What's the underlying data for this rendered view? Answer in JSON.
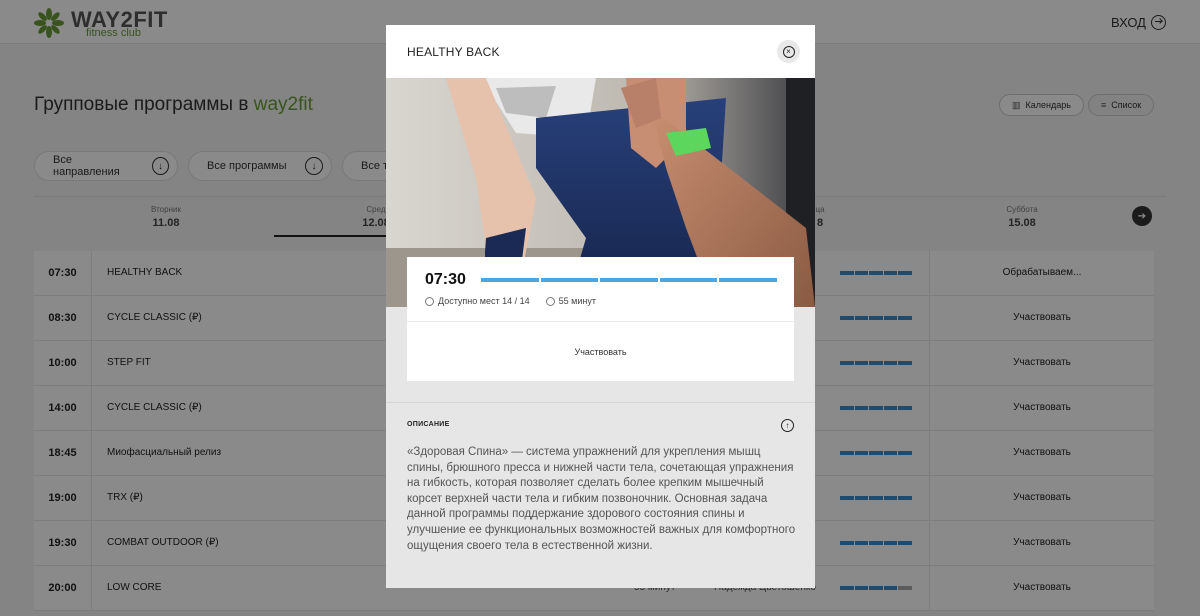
{
  "header": {
    "logo_title": "WAY2FIT",
    "logo_sub": "fitness club",
    "login_label": "ВХОД"
  },
  "page": {
    "title": "Групповые программы в",
    "title_accent": "way2fit",
    "view_calendar": "Календарь",
    "view_list": "Список"
  },
  "filters": [
    "Все направления",
    "Все программы",
    "Все тр"
  ],
  "days": [
    {
      "name": "Вторник",
      "date": "11.08"
    },
    {
      "name": "Сред",
      "date": "12.08"
    },
    {
      "name": "ца",
      "date": "8"
    },
    {
      "name": "Суббота",
      "date": "15.08"
    }
  ],
  "schedule": [
    {
      "time": "07:30",
      "name": "HEALTHY BACK",
      "action": "Обрабатываем...",
      "filled": 5
    },
    {
      "time": "08:30",
      "name": "CYCLE CLASSIC (₽)",
      "action": "Участвовать",
      "filled": 5
    },
    {
      "time": "10:00",
      "name": "STEP FIT",
      "action": "Участвовать",
      "filled": 5
    },
    {
      "time": "14:00",
      "name": "CYCLE CLASSIC (₽)",
      "action": "Участвовать",
      "filled": 5
    },
    {
      "time": "18:45",
      "name": "Миофасциальный релиз",
      "action": "Участвовать",
      "filled": 5
    },
    {
      "time": "19:00",
      "name": "TRX (₽)",
      "action": "Участвовать",
      "filled": 5
    },
    {
      "time": "19:30",
      "name": "COMBAT OUTDOOR (₽)",
      "action": "Участвовать",
      "filled": 5
    },
    {
      "time": "20:00",
      "name": "LOW CORE",
      "action": "Участвовать",
      "filled": 4,
      "duration": "55 минут",
      "trainer": "Надежда Цветошенко"
    }
  ],
  "modal": {
    "title": "HEALTHY BACK",
    "time": "07:30",
    "places": "Доступно мест 14 / 14",
    "duration": "55 минут",
    "join_label": "Участвовать",
    "description_heading": "ОПИСАНИЕ",
    "description": "«Здоровая Спина» — система упражнений для укрепления мышц спины, брюшного пресса и нижней части тела, сочетающая упражнения на гибкость, которая позволяет сделать более крепким мышечный корсет верхней части тела и гибким позвоночник. Основная задача данной программы поддержание здорового состояния спины и улучшение ее функциональных возможностей важных для комфортного ощущения своего тела в естественной жизни."
  },
  "colors": {
    "accent_green": "#6a9a3a",
    "bar_blue": "#3a8ccc",
    "modal_bar_blue": "#49a6e0",
    "wristband": "#5cd65c"
  },
  "icons": {
    "close": "close-icon",
    "login": "login-arrow-icon",
    "filter": "chevron-down-circle-icon",
    "next": "arrow-right-circle-icon",
    "desc_toggle": "chevron-up-circle-icon"
  }
}
